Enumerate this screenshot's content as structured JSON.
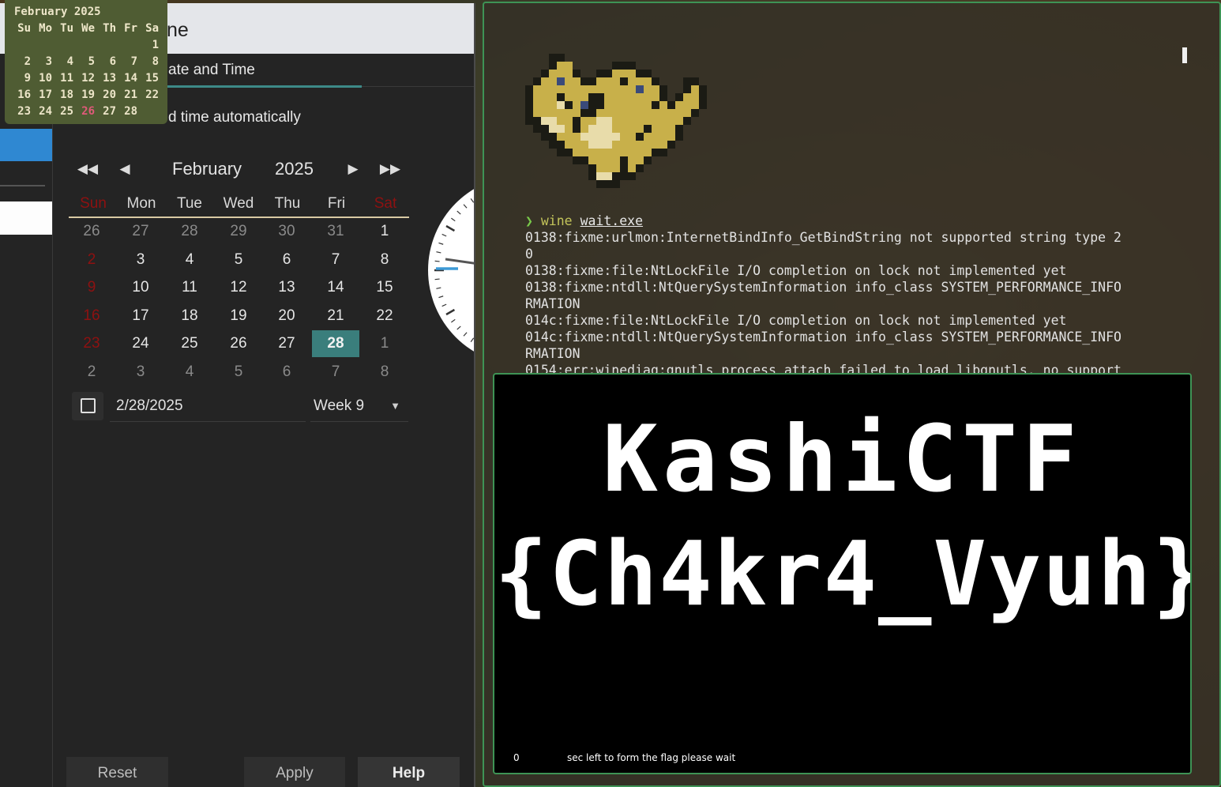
{
  "datetime_window": {
    "title_fragment": "ne",
    "tab_label": "ate and Time",
    "auto_time_label": "d time automatically",
    "calendar": {
      "month": "February",
      "year": "2025",
      "nav": {
        "prev_year": "◀◀",
        "prev_month": "◀",
        "next_month": "▶",
        "next_year": "▶▶"
      },
      "weekdays": [
        "Sun",
        "Mon",
        "Tue",
        "Wed",
        "Thu",
        "Fri",
        "Sat"
      ],
      "weeks": [
        [
          "26",
          "27",
          "28",
          "29",
          "30",
          "31",
          "1"
        ],
        [
          "2",
          "3",
          "4",
          "5",
          "6",
          "7",
          "8"
        ],
        [
          "9",
          "10",
          "11",
          "12",
          "13",
          "14",
          "15"
        ],
        [
          "16",
          "17",
          "18",
          "19",
          "20",
          "21",
          "22"
        ],
        [
          "23",
          "24",
          "25",
          "26",
          "27",
          "28",
          "1"
        ],
        [
          "2",
          "3",
          "4",
          "5",
          "6",
          "7",
          "8"
        ]
      ],
      "selected_day": "28"
    },
    "date_entry_value": "2/28/2025",
    "week_select_value": "Week 9",
    "buttons": {
      "reset": "Reset",
      "apply": "Apply",
      "help": "Help"
    }
  },
  "mini_calendar": {
    "title": "February 2025",
    "weekdays": [
      "Su",
      "Mo",
      "Tu",
      "We",
      "Th",
      "Fr",
      "Sa"
    ],
    "weeks": [
      [
        "",
        "",
        "",
        "",
        "",
        "",
        "1"
      ],
      [
        "2",
        "3",
        "4",
        "5",
        "6",
        "7",
        "8"
      ],
      [
        "9",
        "10",
        "11",
        "12",
        "13",
        "14",
        "15"
      ],
      [
        "16",
        "17",
        "18",
        "19",
        "20",
        "21",
        "22"
      ],
      [
        "23",
        "24",
        "25",
        "26",
        "27",
        "28",
        ""
      ]
    ],
    "today": "26"
  },
  "terminal": {
    "prompt_arrow": "❯",
    "command": "wine",
    "argument": "wait.exe",
    "output_lines": [
      "0138:fixme:urlmon:InternetBindInfo_GetBindString not supported string type 2",
      "0",
      "0138:fixme:file:NtLockFile I/O completion on lock not implemented yet",
      "0138:fixme:ntdll:NtQuerySystemInformation info_class SYSTEM_PERFORMANCE_INFO",
      "RMATION",
      "014c:fixme:file:NtLockFile I/O completion on lock not implemented yet",
      "014c:fixme:ntdll:NtQuerySystemInformation info_class SYSTEM_PERFORMANCE_INFO",
      "RMATION",
      "0154:err:winediag:gnutls_process_attach failed to load libgnutls, no support"
    ]
  },
  "flag_window": {
    "line1": "KashiCTF",
    "line2": "{Ch4kr4_Vyuh}",
    "countdown_value": "0",
    "countdown_text": "sec left to form the flag please wait"
  },
  "colors": {
    "accent_teal": "#3a7e7c",
    "sidebar_blue": "#2f88d2",
    "weekend_red": "#8e1111",
    "terminal_border": "#3e9355",
    "mini_cal_bg": "#4f5c33",
    "today_pink": "#e05a7a"
  }
}
